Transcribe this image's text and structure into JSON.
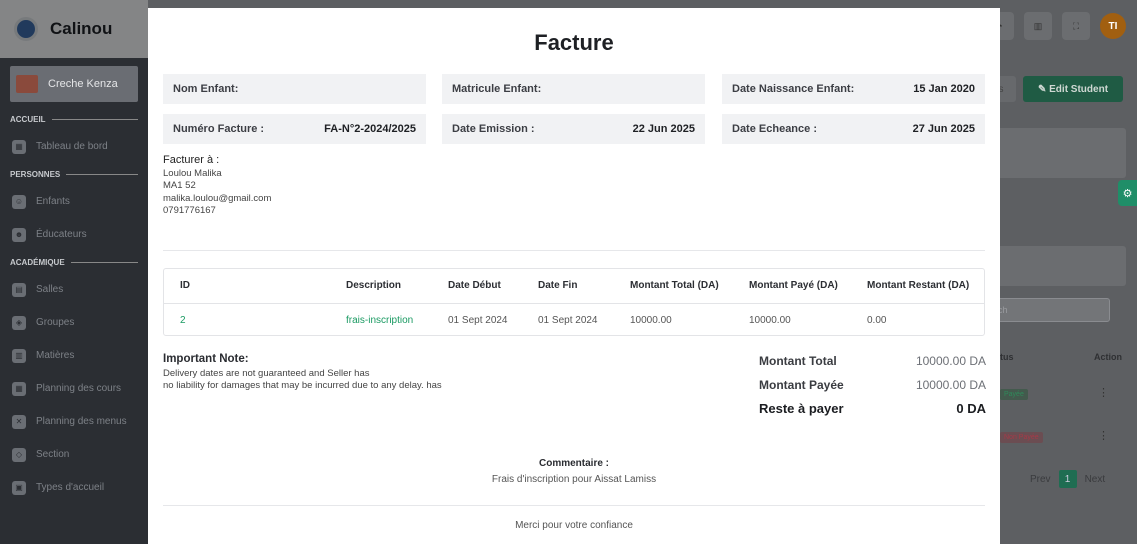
{
  "app": {
    "name": "Calinou",
    "creche": "Creche Kenza",
    "avatar_initials": "TI"
  },
  "sidebar": {
    "sections": [
      {
        "title": "ACCUEIL",
        "items": [
          {
            "label": "Tableau de bord",
            "icon": "dashboard-icon"
          }
        ]
      },
      {
        "title": "PERSONNES",
        "items": [
          {
            "label": "Enfants",
            "icon": "child-icon"
          },
          {
            "label": "Éducateurs",
            "icon": "teacher-icon"
          }
        ]
      },
      {
        "title": "ACADÉMIQUE",
        "items": [
          {
            "label": "Salles",
            "icon": "room-icon"
          },
          {
            "label": "Groupes",
            "icon": "group-icon"
          },
          {
            "label": "Matières",
            "icon": "subject-icon"
          },
          {
            "label": "Planning des cours",
            "icon": "calendar-icon"
          },
          {
            "label": "Planning des menus",
            "icon": "menu-icon"
          },
          {
            "label": "Section",
            "icon": "section-icon"
          },
          {
            "label": "Types d'accueil",
            "icon": "type-icon"
          }
        ]
      }
    ]
  },
  "background": {
    "edit_button": "Edit Student",
    "search_placeholder": "rch",
    "table_headers": [
      "tus",
      "Action"
    ],
    "badges": [
      "Payée",
      "Non Payée"
    ],
    "pager": {
      "prev": "Prev",
      "page": "1",
      "next": "Next"
    }
  },
  "invoice": {
    "title": "Facture",
    "fields": {
      "nom_enfant": {
        "label": "Nom Enfant:",
        "value": ""
      },
      "matricule": {
        "label": "Matricule Enfant:",
        "value": ""
      },
      "date_naissance": {
        "label": "Date Naissance Enfant:",
        "value": "15 Jan 2020"
      },
      "numero": {
        "label": "Numéro Facture :",
        "value": "FA-N°2-2024/2025"
      },
      "date_emission": {
        "label": "Date Emission :",
        "value": "22 Jun 2025"
      },
      "date_echeance": {
        "label": "Date Echeance :",
        "value": "27 Jun 2025"
      }
    },
    "bill_to": {
      "heading": "Facturer à :",
      "name": "Loulou Malika",
      "address": "MA1 52",
      "email": "malika.loulou@gmail.com",
      "phone": "0791776167"
    },
    "table": {
      "headers": [
        "ID",
        "Description",
        "Date Début",
        "Date Fin",
        "Montant Total (DA)",
        "Montant Payé (DA)",
        "Montant Restant (DA)"
      ],
      "rows": [
        [
          "2",
          "frais-inscription",
          "01 Sept 2024",
          "01 Sept 2024",
          "10000.00",
          "10000.00",
          "0.00"
        ]
      ]
    },
    "note": {
      "heading": "Important Note:",
      "line1": "Delivery dates are not guaranteed and Seller has",
      "line2": "no liability for damages that may be incurred due to any delay. has"
    },
    "totals": {
      "total_label": "Montant Total",
      "total_value": "10000.00 DA",
      "paid_label": "Montant Payée",
      "paid_value": "10000.00 DA",
      "rest_label": "Reste à payer",
      "rest_value": "0 DA"
    },
    "comment": {
      "heading": "Commentaire :",
      "text": "Frais d'inscription pour Aissat Lamiss"
    },
    "thanks": "Merci pour votre confiance"
  }
}
